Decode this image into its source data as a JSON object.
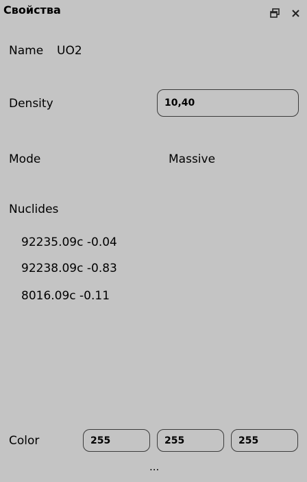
{
  "title": "Свойства",
  "name": {
    "label": "Name",
    "value": "UO2"
  },
  "density": {
    "label": "Density",
    "value": "10,40"
  },
  "mode": {
    "label": "Mode",
    "value": "Massive"
  },
  "nuclides": {
    "label": "Nuclides",
    "items": [
      "92235.09c -0.04",
      "92238.09c -0.83",
      "8016.09c -0.11"
    ]
  },
  "color": {
    "label": "Color",
    "r": "255",
    "g": "255",
    "b": "255"
  },
  "more": "..."
}
